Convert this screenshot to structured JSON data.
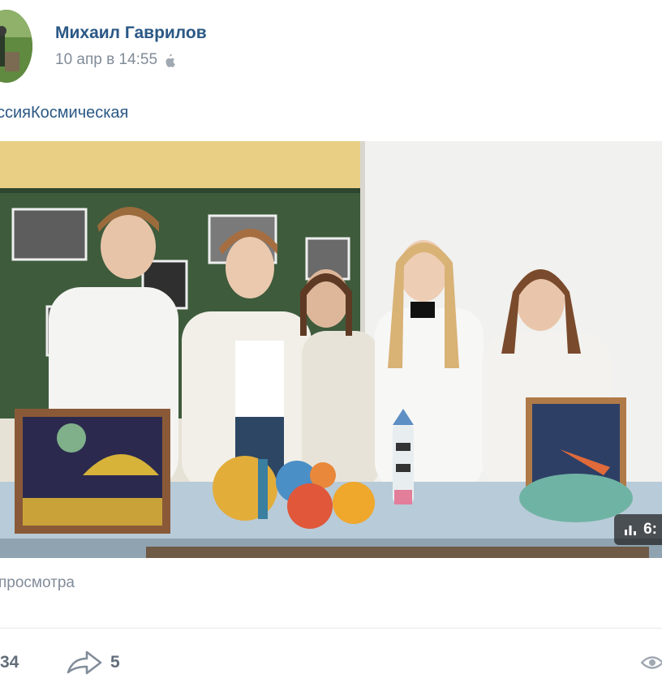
{
  "post": {
    "author": "Михаил Гаврилов",
    "date": "10 апр в 14:55",
    "date_icon": "apple-icon",
    "text": "ссияКосмическая",
    "video": {
      "duration": "6:",
      "duration_icon": "bars-icon"
    },
    "views_text": "просмотра",
    "likes_count": "34",
    "shares_count": "5",
    "share_icon": "share-arrow-icon",
    "views_icon": "eye-icon"
  },
  "colors": {
    "link": "#2a5885",
    "secondary": "#818c99",
    "counter": "#626d7a",
    "divider": "#e7e8ec"
  }
}
